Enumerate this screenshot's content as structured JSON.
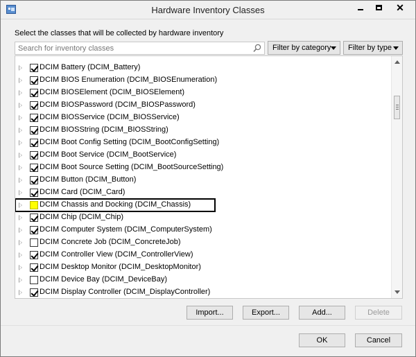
{
  "window": {
    "title": "Hardware Inventory Classes"
  },
  "description": "Select the classes that will be collected by hardware inventory",
  "search": {
    "placeholder": "Search for inventory classes"
  },
  "filters": {
    "category_label": "Filter by category",
    "type_label": "Filter by type"
  },
  "classes": [
    {
      "label": "DCIM Battery (DCIM_Battery)",
      "checked": true,
      "highlight": false,
      "outlined": false
    },
    {
      "label": "DCIM BIOS Enumeration (DCIM_BIOSEnumeration)",
      "checked": true,
      "highlight": false,
      "outlined": false
    },
    {
      "label": "DCIM BIOSElement (DCIM_BIOSElement)",
      "checked": true,
      "highlight": false,
      "outlined": false
    },
    {
      "label": "DCIM BIOSPassword (DCIM_BIOSPassword)",
      "checked": true,
      "highlight": false,
      "outlined": false
    },
    {
      "label": "DCIM BIOSService (DCIM_BIOSService)",
      "checked": true,
      "highlight": false,
      "outlined": false
    },
    {
      "label": "DCIM BIOSString (DCIM_BIOSString)",
      "checked": true,
      "highlight": false,
      "outlined": false
    },
    {
      "label": "DCIM Boot Config Setting (DCIM_BootConfigSetting)",
      "checked": true,
      "highlight": false,
      "outlined": false
    },
    {
      "label": "DCIM Boot Service (DCIM_BootService)",
      "checked": true,
      "highlight": false,
      "outlined": false
    },
    {
      "label": "DCIM Boot Source Setting (DCIM_BootSourceSetting)",
      "checked": true,
      "highlight": false,
      "outlined": false
    },
    {
      "label": "DCIM Button (DCIM_Button)",
      "checked": true,
      "highlight": false,
      "outlined": false
    },
    {
      "label": "DCIM Card (DCIM_Card)",
      "checked": true,
      "highlight": false,
      "outlined": false
    },
    {
      "label": "DCIM Chassis and Docking (DCIM_Chassis)",
      "checked": false,
      "highlight": true,
      "outlined": true
    },
    {
      "label": "DCIM Chip (DCIM_Chip)",
      "checked": true,
      "highlight": false,
      "outlined": false
    },
    {
      "label": "DCIM Computer System (DCIM_ComputerSystem)",
      "checked": true,
      "highlight": false,
      "outlined": false
    },
    {
      "label": "DCIM Concrete Job (DCIM_ConcreteJob)",
      "checked": false,
      "highlight": false,
      "outlined": false
    },
    {
      "label": "DCIM Controller View (DCIM_ControllerView)",
      "checked": true,
      "highlight": false,
      "outlined": false
    },
    {
      "label": "DCIM Desktop Monitor (DCIM_DesktopMonitor)",
      "checked": true,
      "highlight": false,
      "outlined": false
    },
    {
      "label": "DCIM Device Bay (DCIM_DeviceBay)",
      "checked": false,
      "highlight": false,
      "outlined": false
    },
    {
      "label": "DCIM Display Controller (DCIM_DisplayController)",
      "checked": true,
      "highlight": false,
      "outlined": false
    }
  ],
  "actions": {
    "import": "Import...",
    "export": "Export...",
    "add": "Add...",
    "delete": "Delete"
  },
  "dialog": {
    "ok": "OK",
    "cancel": "Cancel"
  },
  "colors": {
    "highlight": "#ffff00",
    "outline": "#000000"
  }
}
